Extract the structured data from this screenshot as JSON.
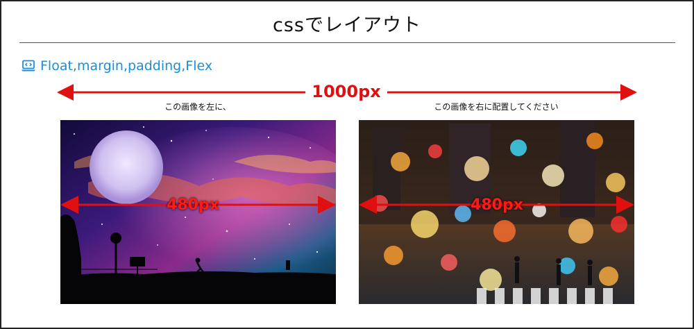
{
  "page": {
    "title": "cssでレイアウト",
    "subheading": "Float,margin,padding,Flex",
    "subheading_icon": "laptop-code-icon"
  },
  "dimension": {
    "total_label": "1000px",
    "left_image_label": "480px",
    "right_image_label": "480px"
  },
  "captions": {
    "left": "この画像を左に、",
    "right": "この画像を右に配置してください"
  },
  "images": {
    "left": "night sky with moon and cyclist silhouette",
    "right": "city street at night with bokeh lights and crosswalk"
  },
  "colors": {
    "accent_red": "#e01010",
    "link_blue": "#1a8fd6"
  }
}
